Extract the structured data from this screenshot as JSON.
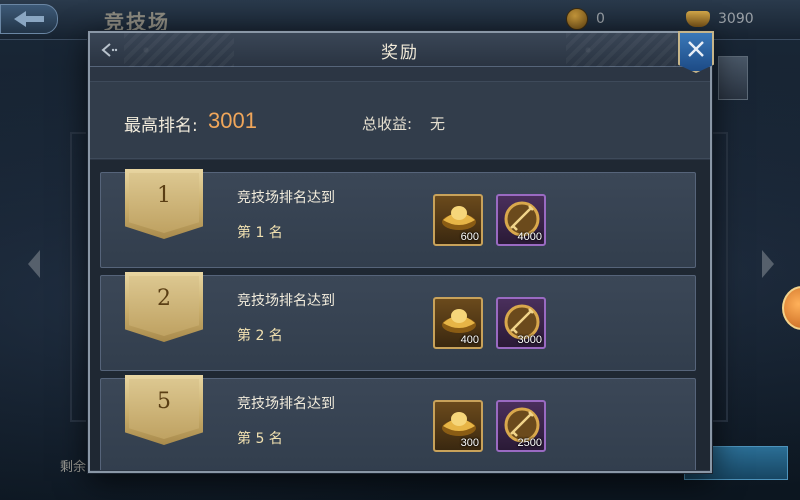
{
  "background": {
    "title": "竞技场",
    "resources": [
      {
        "icon": "coin-icon",
        "value": "0"
      },
      {
        "icon": "gold-ingot-icon",
        "value": "3090"
      }
    ],
    "bottom_text": "剩余"
  },
  "dialog": {
    "title": "奖励",
    "summary": {
      "best_rank_label": "最高排名:",
      "best_rank_value": "3001",
      "income_label": "总收益:",
      "income_value": "无"
    },
    "rows": [
      {
        "rank": "1",
        "line1": "竞技场排名达到",
        "line2": "第 1 名",
        "items": [
          {
            "type": "gold-ingot-icon",
            "qty": "600"
          },
          {
            "type": "sword-medal-icon",
            "qty": "4000"
          }
        ]
      },
      {
        "rank": "2",
        "line1": "竞技场排名达到",
        "line2": "第 2 名",
        "items": [
          {
            "type": "gold-ingot-icon",
            "qty": "400"
          },
          {
            "type": "sword-medal-icon",
            "qty": "3000"
          }
        ]
      },
      {
        "rank": "5",
        "line1": "竞技场排名达到",
        "line2": "第 5 名",
        "items": [
          {
            "type": "gold-ingot-icon",
            "qty": "300"
          },
          {
            "type": "sword-medal-icon",
            "qty": "2500"
          }
        ]
      }
    ]
  },
  "colors": {
    "rank_value": "#f0a65a",
    "badge_gold": "#c9ae6c",
    "close_blue": "#2a62a0",
    "item_purple_border": "#9a6ac2",
    "item_gold_border": "#c8a25a"
  }
}
